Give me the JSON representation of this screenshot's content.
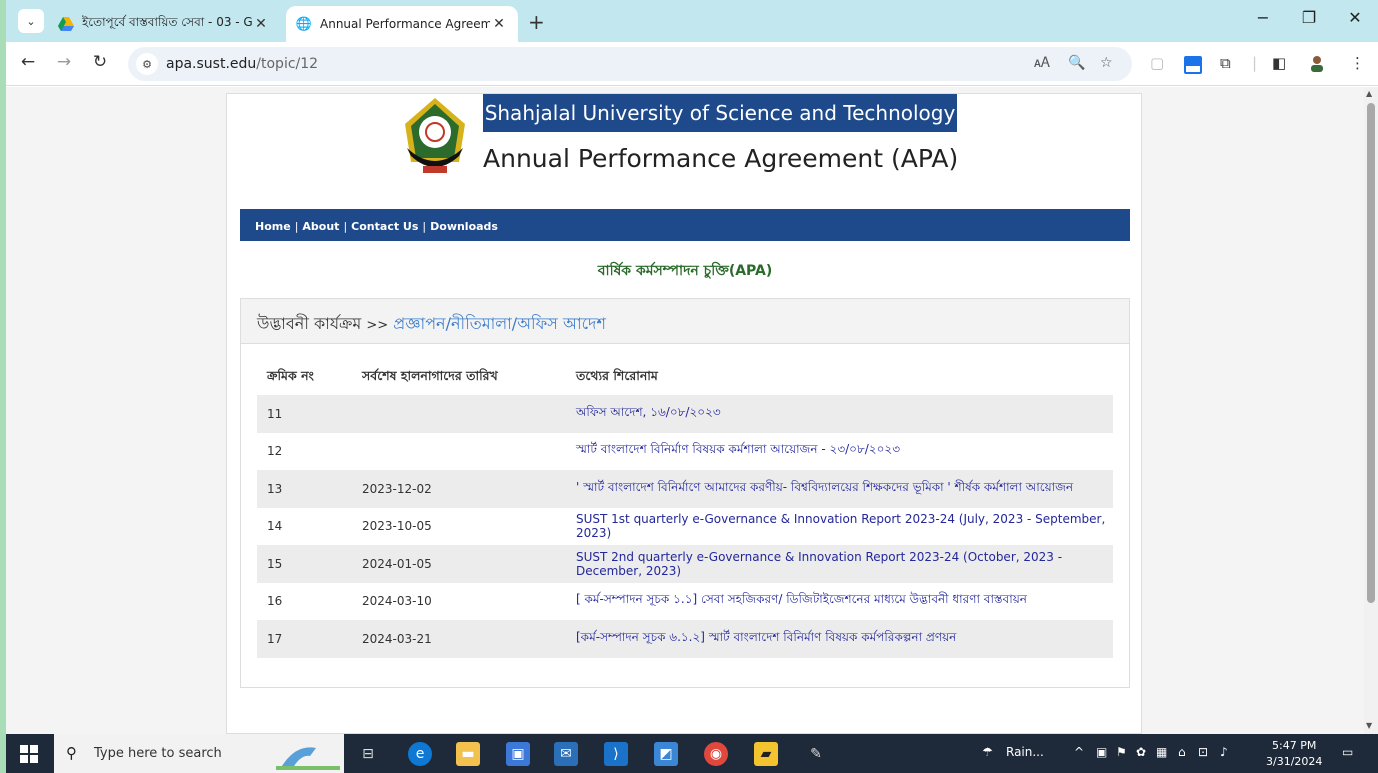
{
  "browser": {
    "tabs": [
      {
        "title": "ইতোপূর্বে বাস্তবায়িত সেবা - 03 - G",
        "active": false
      },
      {
        "title": "Annual Performance Agreemen",
        "active": true
      }
    ],
    "url_host": "apa.sust.edu",
    "url_path": "/topic/12"
  },
  "header": {
    "university": "Shahjalal University of Science and Technology",
    "subtitle": "Annual Performance Agreement (APA)"
  },
  "nav": {
    "home": "Home",
    "about": "About",
    "contact": "Contact Us",
    "downloads": "Downloads",
    "separator": "|"
  },
  "page": {
    "heading": "বার্ষিক কর্মসম্পাদন চুক্তি(APA)",
    "breadcrumb_root": "উদ্ভাবনী কার্যক্রম",
    "breadcrumb_arrow": ">>",
    "breadcrumb_current": "প্রজ্ঞাপন/নীতিমালা/অফিস আদেশ"
  },
  "table": {
    "headers": [
      "ক্রমিক নং",
      "সর্বশেষ হালনাগাদের তারিখ",
      "তথ্যের শিরোনাম"
    ],
    "rows": [
      {
        "no": "11",
        "date": "",
        "title": "অফিস আদেশ, ১৬/০৮/২০২৩"
      },
      {
        "no": "12",
        "date": "",
        "title": "স্মার্ট বাংলাদেশ বিনির্মাণ বিষয়ক কর্মশালা আয়োজন - ২৩/০৮/২০২৩"
      },
      {
        "no": "13",
        "date": "2023-12-02",
        "title": "' স্মার্ট বাংলাদেশ বিনির্মাণে আমাদের করণীয়- বিশ্ববিদ্যালয়ের শিক্ষকদের ভূমিকা ' শীর্ষক কর্মশালা আয়োজন"
      },
      {
        "no": "14",
        "date": "2023-10-05",
        "title": "SUST 1st quarterly e-Governance & Innovation Report 2023-24 (July, 2023 - September, 2023)"
      },
      {
        "no": "15",
        "date": "2024-01-05",
        "title": "SUST 2nd quarterly e-Governance & Innovation Report 2023-24 (October, 2023 - December, 2023)"
      },
      {
        "no": "16",
        "date": "2024-03-10",
        "title": "[ কর্ম-সম্পাদন সূচক ১.১] সেবা সহজিকরণ/ ডিজিটাইজেশনের মাধ্যমে উদ্ভাবনী ধারণা বাস্তবায়ন"
      },
      {
        "no": "17",
        "date": "2024-03-21",
        "title": "[কর্ম-সম্পাদন সূচক ৬.১.২] স্মার্ট বাংলাদেশ বিনির্মাণ বিষয়ক কর্মপরিকল্পনা প্রণয়ন"
      }
    ]
  },
  "taskbar": {
    "search_placeholder": "Type here to search",
    "weather": "Rain...",
    "time": "5:47 PM",
    "date": "3/31/2024"
  },
  "icons": [
    "search-icon",
    "zoom-icon",
    "star-icon",
    "extensions-icon",
    "sidepanel-icon",
    "menu-icon"
  ],
  "colors": {
    "brand_blue": "#1e4a8c",
    "heading_green": "#2a6a2a",
    "link_blue": "#23279a"
  }
}
